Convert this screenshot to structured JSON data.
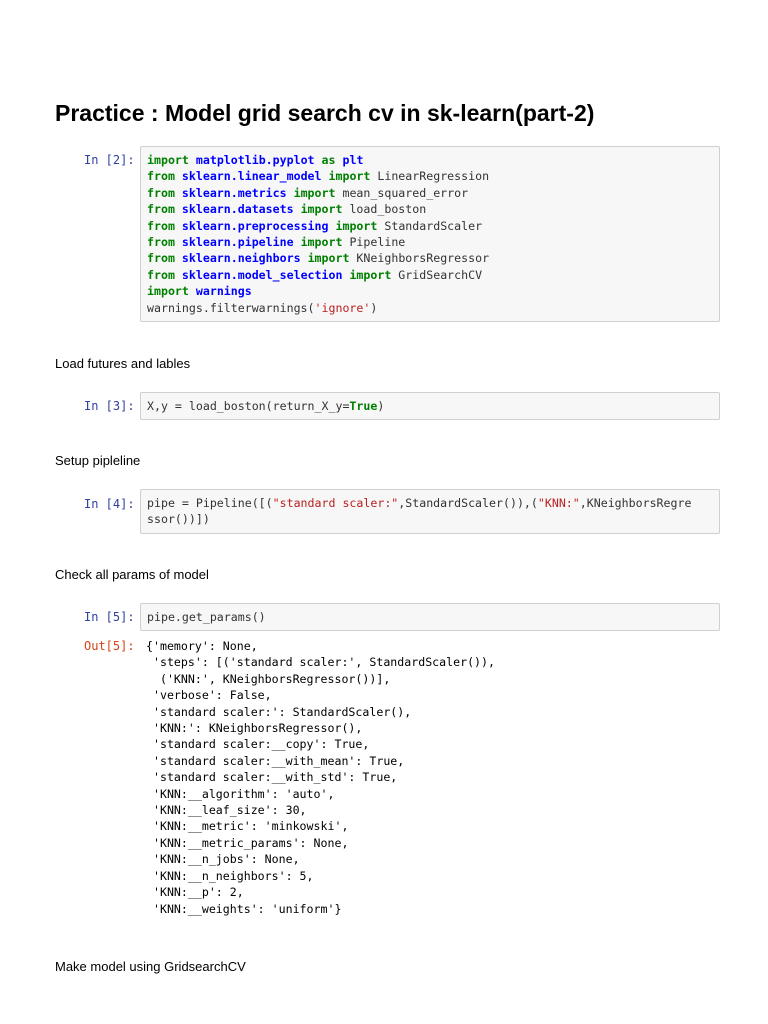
{
  "title": "Practice : Model grid search cv in sk-learn(part-2)",
  "cells": [
    {
      "prompt": "In [2]:",
      "lines": [
        [
          [
            "kw",
            "import"
          ],
          [
            "t",
            " "
          ],
          [
            "mod",
            "matplotlib.pyplot"
          ],
          [
            "t",
            " "
          ],
          [
            "kw",
            "as"
          ],
          [
            "t",
            " "
          ],
          [
            "mod",
            "plt"
          ]
        ],
        [
          [
            "kw",
            "from"
          ],
          [
            "t",
            " "
          ],
          [
            "mod",
            "sklearn.linear_model"
          ],
          [
            "t",
            " "
          ],
          [
            "kw",
            "import"
          ],
          [
            "t",
            " LinearRegression"
          ]
        ],
        [
          [
            "kw",
            "from"
          ],
          [
            "t",
            " "
          ],
          [
            "mod",
            "sklearn.metrics"
          ],
          [
            "t",
            " "
          ],
          [
            "kw",
            "import"
          ],
          [
            "t",
            " mean_squared_error"
          ]
        ],
        [
          [
            "kw",
            "from"
          ],
          [
            "t",
            " "
          ],
          [
            "mod",
            "sklearn.datasets"
          ],
          [
            "t",
            " "
          ],
          [
            "kw",
            "import"
          ],
          [
            "t",
            " load_boston"
          ]
        ],
        [
          [
            "kw",
            "from"
          ],
          [
            "t",
            " "
          ],
          [
            "mod",
            "sklearn.preprocessing"
          ],
          [
            "t",
            " "
          ],
          [
            "kw",
            "import"
          ],
          [
            "t",
            " StandardScaler"
          ]
        ],
        [
          [
            "kw",
            "from"
          ],
          [
            "t",
            " "
          ],
          [
            "mod",
            "sklearn.pipeline"
          ],
          [
            "t",
            " "
          ],
          [
            "kw",
            "import"
          ],
          [
            "t",
            " Pipeline"
          ]
        ],
        [
          [
            "kw",
            "from"
          ],
          [
            "t",
            " "
          ],
          [
            "mod",
            "sklearn.neighbors"
          ],
          [
            "t",
            " "
          ],
          [
            "kw",
            "import"
          ],
          [
            "t",
            " KNeighborsRegressor"
          ]
        ],
        [
          [
            "kw",
            "from"
          ],
          [
            "t",
            " "
          ],
          [
            "mod",
            "sklearn.model_selection"
          ],
          [
            "t",
            " "
          ],
          [
            "kw",
            "import"
          ],
          [
            "t",
            " GridSearchCV"
          ]
        ],
        [
          [
            "kw",
            "import"
          ],
          [
            "t",
            " "
          ],
          [
            "mod",
            "warnings"
          ]
        ],
        [
          [
            "t",
            "warnings.filterwarnings("
          ],
          [
            "str",
            "'ignore'"
          ],
          [
            "t",
            ")"
          ]
        ]
      ]
    },
    {
      "prompt": "In [3]:",
      "lines": [
        [
          [
            "t",
            "X,y = load_boston(return_X_y="
          ],
          [
            "kw",
            "True"
          ],
          [
            "t",
            ")"
          ]
        ]
      ]
    },
    {
      "prompt": "In [4]:",
      "lines": [
        [
          [
            "t",
            "pipe = Pipeline([("
          ],
          [
            "str",
            "\"standard scaler:\""
          ],
          [
            "t",
            ",StandardScaler()),("
          ],
          [
            "str",
            "\"KNN:\""
          ],
          [
            "t",
            ",KNeighborsRegre"
          ]
        ],
        [
          [
            "t",
            "ssor())])"
          ]
        ]
      ]
    },
    {
      "prompt": "In [5]:",
      "lines": [
        [
          [
            "t",
            "pipe.get_params()"
          ]
        ]
      ]
    }
  ],
  "markdown": [
    "Load futures and lables",
    "Setup pipleline",
    "Check all params of model",
    "Make model using GridsearchCV"
  ],
  "output": {
    "prompt": "Out[5]:",
    "lines": [
      "{'memory': None,",
      " 'steps': [('standard scaler:', StandardScaler()),",
      "  ('KNN:', KNeighborsRegressor())],",
      " 'verbose': False,",
      " 'standard scaler:': StandardScaler(),",
      " 'KNN:': KNeighborsRegressor(),",
      " 'standard scaler:__copy': True,",
      " 'standard scaler:__with_mean': True,",
      " 'standard scaler:__with_std': True,",
      " 'KNN:__algorithm': 'auto',",
      " 'KNN:__leaf_size': 30,",
      " 'KNN:__metric': 'minkowski',",
      " 'KNN:__metric_params': None,",
      " 'KNN:__n_jobs': None,",
      " 'KNN:__n_neighbors': 5,",
      " 'KNN:__p': 2,",
      " 'KNN:__weights': 'uniform'}"
    ]
  }
}
